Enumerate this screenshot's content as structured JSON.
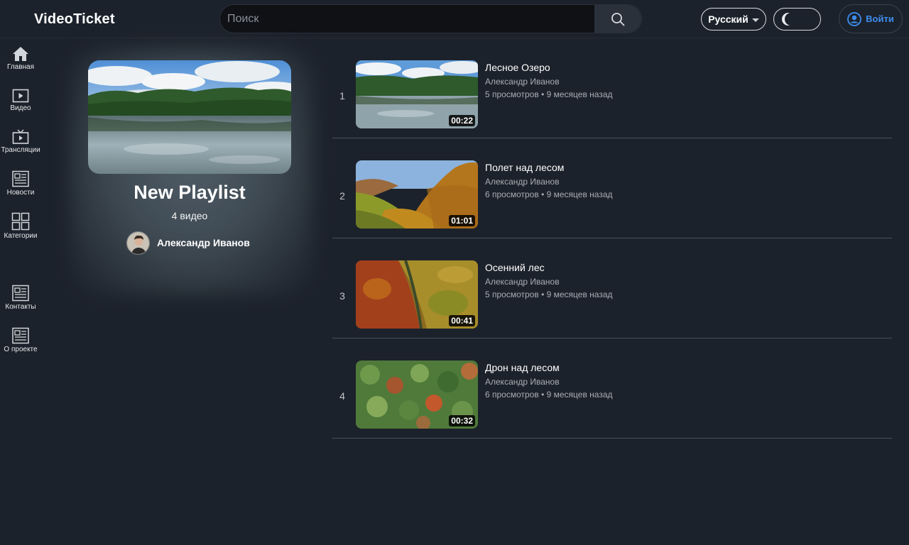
{
  "header": {
    "logo": "VideoTicket",
    "search_placeholder": "Поиск",
    "language": "Русский",
    "login": "Войти"
  },
  "sidebar": {
    "items": [
      {
        "label": "Главная",
        "icon": "home-icon"
      },
      {
        "label": "Видео",
        "icon": "video-icon"
      },
      {
        "label": "Трансляции",
        "icon": "tv-icon"
      },
      {
        "label": "Новости",
        "icon": "newspaper-icon"
      },
      {
        "label": "Категории",
        "icon": "grid-icon"
      },
      {
        "label": "Контакты",
        "icon": "newspaper-icon"
      },
      {
        "label": "О проекте",
        "icon": "newspaper-icon"
      }
    ]
  },
  "playlist": {
    "title": "New Playlist",
    "count": "4 видео",
    "author": "Александр Иванов"
  },
  "videos": [
    {
      "index": "1",
      "title": "Лесное Озеро",
      "author": "Александр Иванов",
      "meta": "5 просмотров • 9 месяцев назад",
      "duration": "00:22",
      "thumb": "lake"
    },
    {
      "index": "2",
      "title": "Полет над лесом",
      "author": "Александр Иванов",
      "meta": "6 просмотров • 9 месяцев назад",
      "duration": "01:01",
      "thumb": "valley"
    },
    {
      "index": "3",
      "title": "Осенний лес",
      "author": "Александр Иванов",
      "meta": "5 просмотров • 9 месяцев назад",
      "duration": "00:41",
      "thumb": "autumn"
    },
    {
      "index": "4",
      "title": "Дрон над лесом",
      "author": "Александр Иванов",
      "meta": "6 просмотров • 9 месяцев назад",
      "duration": "00:32",
      "thumb": "canopy"
    }
  ],
  "colors": {
    "background": "#1c222b",
    "accent": "#3d8ef0",
    "divider": "#4a515b"
  }
}
